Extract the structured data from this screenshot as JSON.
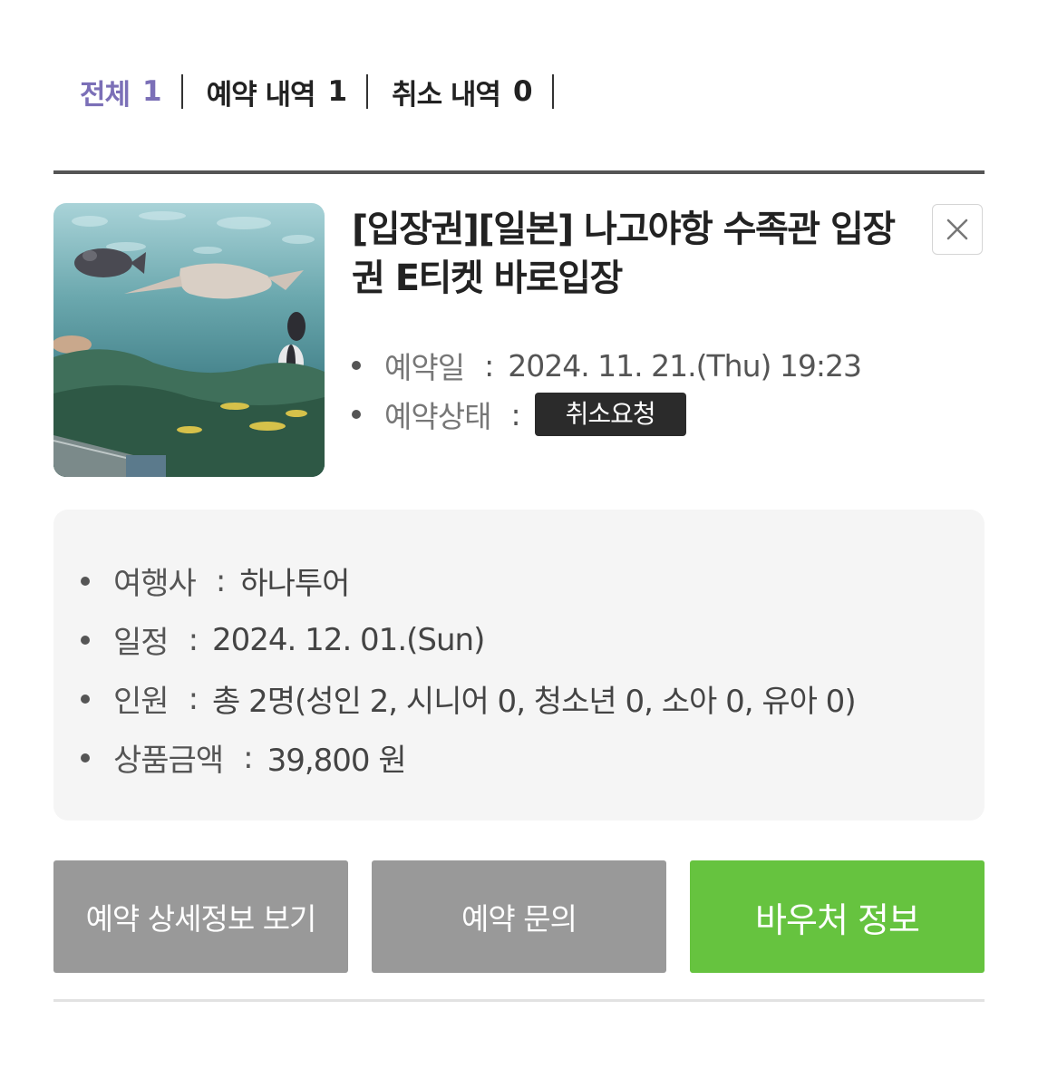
{
  "tabs": [
    {
      "label": "전체",
      "count": "1",
      "active": true
    },
    {
      "label": "예약 내역",
      "count": "1",
      "active": false
    },
    {
      "label": "취소 내역",
      "count": "0",
      "active": false
    }
  ],
  "booking": {
    "title": "[입장권][일본] 나고야항 수족관 입장권 E티켓 바로입장",
    "thumbnail_icon": "aquarium-photo",
    "reservation_date_label": "예약일",
    "reservation_date": "2024. 11. 21.(Thu) 19:23",
    "status_label": "예약상태",
    "status": "취소요청",
    "close_icon": "close-icon"
  },
  "details": {
    "agency_label": "여행사",
    "agency": "하나투어",
    "schedule_label": "일정",
    "schedule": "2024. 12. 01.(Sun)",
    "people_label": "인원",
    "people": "총 2명(성인 2, 시니어 0, 청소년 0, 소아 0, 유아 0)",
    "price_label": "상품금액",
    "price": "39,800 원"
  },
  "actions": {
    "detail_label": "예약 상세정보 보기",
    "inquiry_label": "예약 문의",
    "voucher_label": "바우처 정보"
  },
  "colors": {
    "active_tab": "#7b6fb7",
    "voucher_button": "#66c33f",
    "grey_button": "#999999",
    "status_badge": "#2b2b2b"
  }
}
